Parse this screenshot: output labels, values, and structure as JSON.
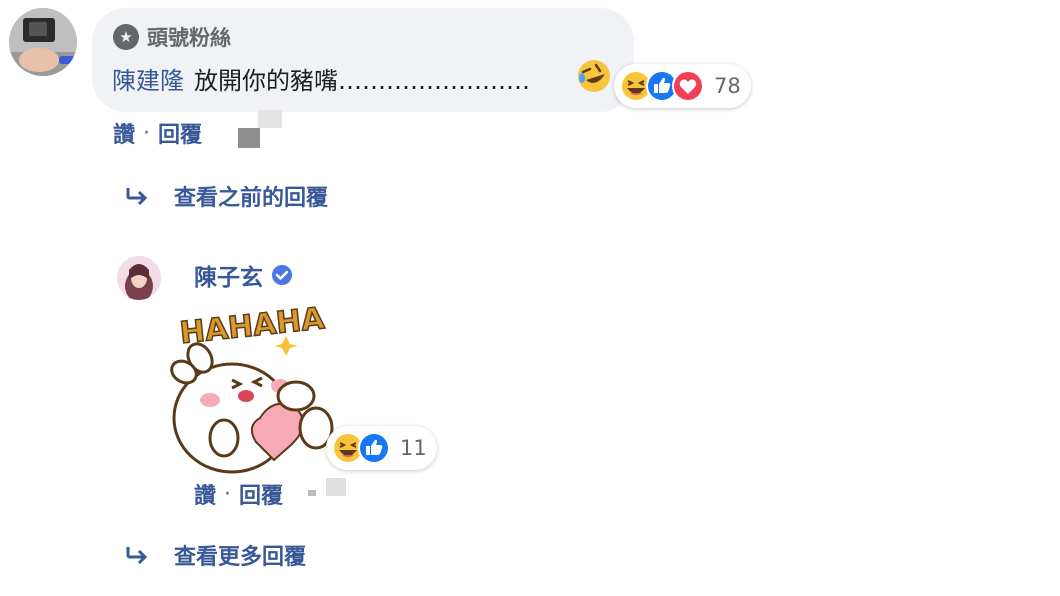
{
  "comment": {
    "badge": "頭號粉絲",
    "mention": "陳建隆",
    "text": "放開你的豬嘴……………………",
    "reaction_count": "78",
    "reactions": [
      "haha-icon",
      "like-icon",
      "love-icon"
    ]
  },
  "comment_actions": {
    "like": "讚",
    "separator": "·",
    "reply": "回覆"
  },
  "view_previous_replies": "查看之前的回覆",
  "reply": {
    "author": "陳子玄",
    "sticker_text": "HAHAHA",
    "reaction_count": "11",
    "reactions": [
      "haha-icon",
      "like-icon"
    ]
  },
  "reply_actions": {
    "like": "讚",
    "separator": "·",
    "reply": "回覆"
  },
  "view_more_replies": "查看更多回覆",
  "colors": {
    "link": "#385898",
    "bubble": "#f0f2f5",
    "meta": "#65676b",
    "like_blue": "#1877f2",
    "love_red": "#f33e58",
    "haha_yellow": "#f7c43a"
  }
}
